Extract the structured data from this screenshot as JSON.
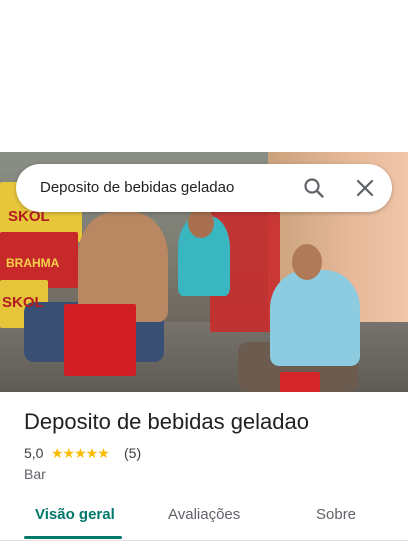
{
  "search": {
    "query": "Deposito de bebidas geladao"
  },
  "place": {
    "title": "Deposito de bebidas geladao",
    "rating": "5,0",
    "stars": "★★★★★",
    "reviews": "(5)",
    "category": "Bar"
  },
  "photo": {
    "brand_labels": [
      "SKOL",
      "BRAHMA",
      "SKOL"
    ]
  },
  "tabs": [
    {
      "label": "Visão geral",
      "active": true
    },
    {
      "label": "Avaliações",
      "active": false
    },
    {
      "label": "Sobre",
      "active": false
    }
  ],
  "colors": {
    "accent": "#00796b",
    "star": "#fbbc04"
  }
}
